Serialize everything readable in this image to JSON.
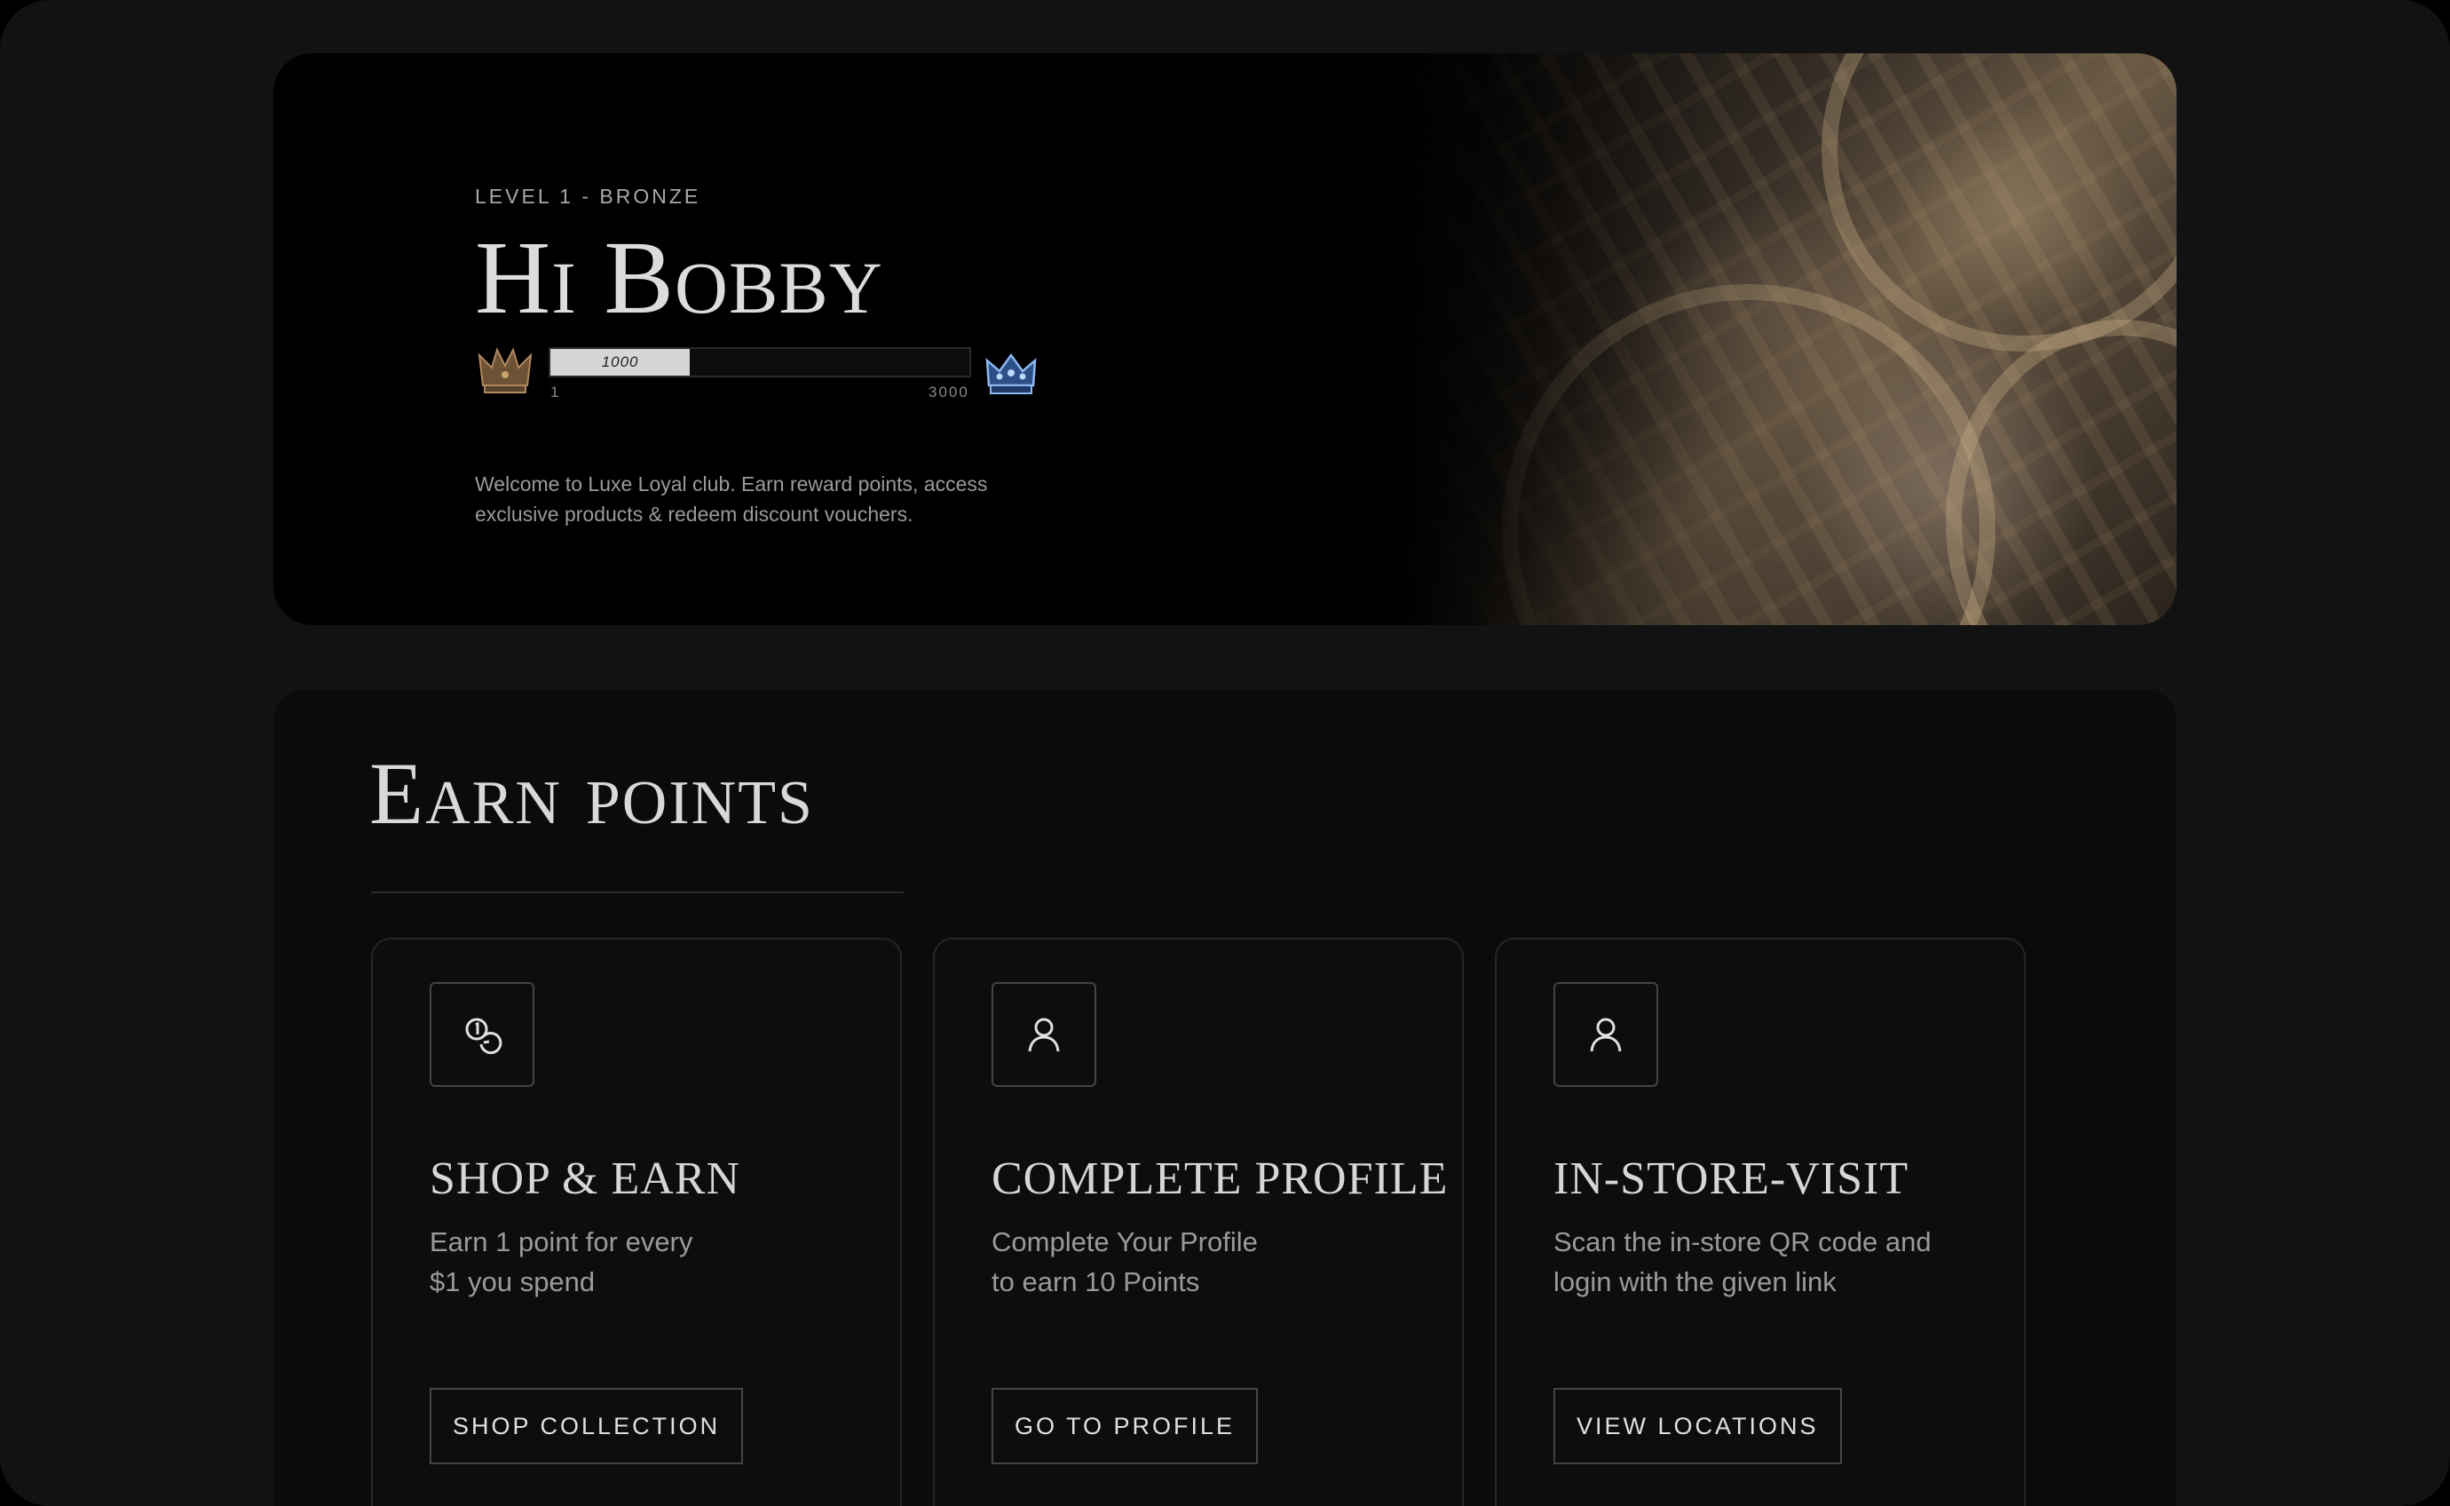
{
  "hero": {
    "level": "LEVEL 1 - BRONZE",
    "greeting": "Hi Bobby",
    "progress": {
      "current": 1000,
      "current_label": "1000",
      "min_label": "1",
      "max_label": "3000",
      "min": 1,
      "max": 3000
    },
    "welcome": "Welcome to Luxe Loyal club. Earn reward points, access exclusive products & redeem discount vouchers.",
    "current_tier_icon": "bronze-crown-icon",
    "next_tier_icon": "blue-crown-icon"
  },
  "earn": {
    "title": "Earn points",
    "cards": [
      {
        "icon": "coins-icon",
        "title": "SHOP & EARN",
        "desc": "Earn 1 point for every\n$1 you spend",
        "button": "SHOP COLLECTION"
      },
      {
        "icon": "user-icon",
        "title": "COMPLETE PROFILE",
        "desc": "Complete Your Profile\nto earn 10 Points",
        "button": "GO TO PROFILE"
      },
      {
        "icon": "user-icon",
        "title": "IN-STORE-VISIT",
        "desc": "Scan the in-store QR code and\nlogin with the given link",
        "button": "VIEW LOCATIONS"
      }
    ]
  },
  "colors": {
    "background": "#121212",
    "hero_bg": "#000000",
    "card_bg": "#0d0d0d",
    "progress_fill": "#d6d6d6",
    "bronze": "#8a6a45",
    "blue_crown": "#5a8fd6"
  }
}
